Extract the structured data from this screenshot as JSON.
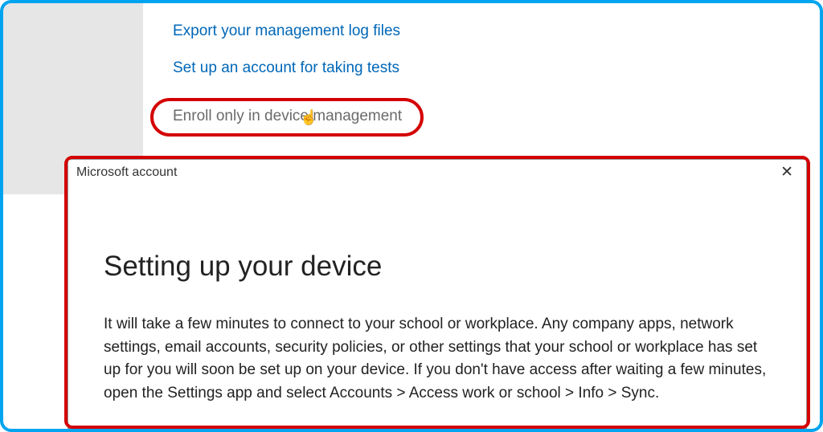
{
  "links": {
    "export_logs": "Export your management log files",
    "setup_tests": "Set up an account for taking tests",
    "enroll_device": "Enroll only in device management"
  },
  "dialog": {
    "title": "Microsoft account",
    "heading": "Setting up your device",
    "body": "It will take a few minutes to connect to your school or workplace. Any company apps, network settings, email accounts, security policies, or other settings that your school or workplace has set up for you will soon be set up on your device. If you don't have access after waiting a few minutes, open the Settings app and select Accounts > Access work or school > Info > Sync."
  },
  "icons": {
    "close": "✕",
    "cursor": "☝"
  }
}
